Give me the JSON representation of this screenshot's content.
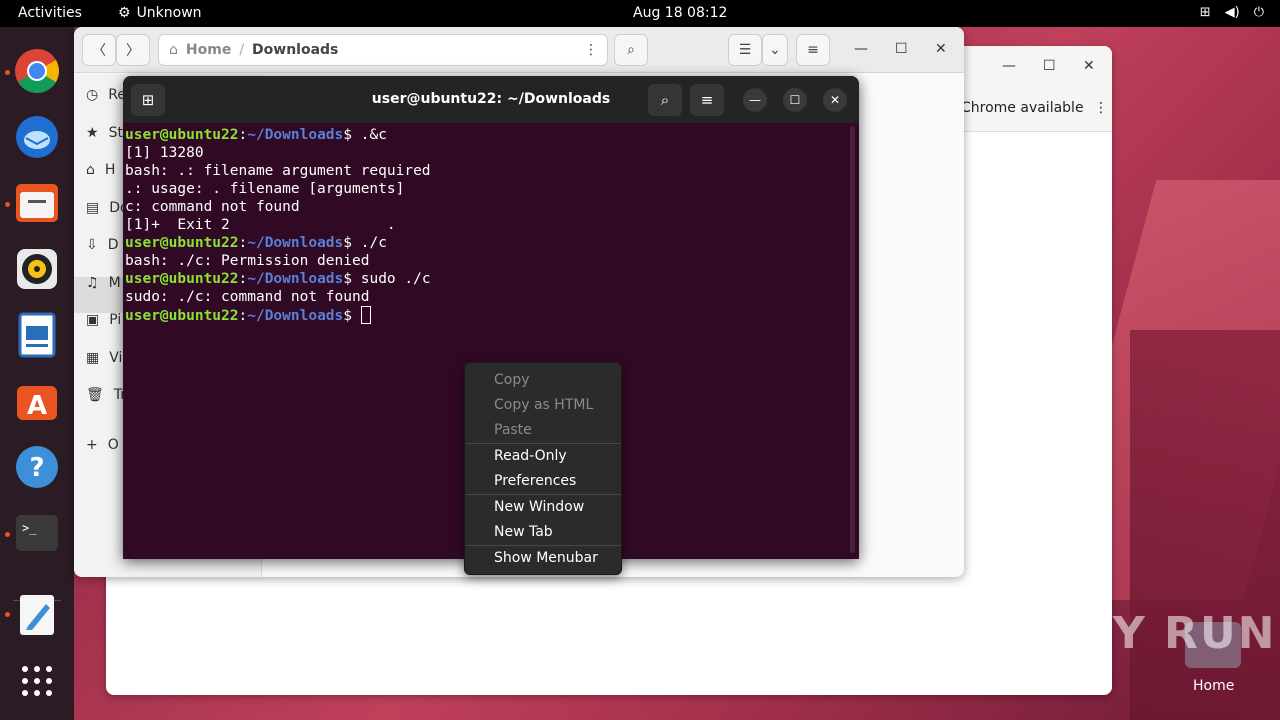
{
  "topbar": {
    "activities": "Activities",
    "app_name": "Unknown",
    "clock": "Aug 18  08:12",
    "tray_icons": [
      "network-icon",
      "volume-icon",
      "power-icon"
    ]
  },
  "dock": {
    "items": [
      "chrome",
      "thunderbird",
      "files",
      "rhythmbox",
      "writer",
      "app-center",
      "help",
      "terminal",
      "text-editor",
      "show-apps"
    ]
  },
  "bgwin": {
    "notice": "Chrome available"
  },
  "files": {
    "path_home": "Home",
    "path_sep": "/",
    "path_current": "Downloads",
    "sidebar": [
      "Re",
      "St",
      "H",
      "Do",
      "D",
      "M",
      "Pi",
      "Vi",
      "Tr",
      "O"
    ]
  },
  "terminal": {
    "title": "user@ubuntu22: ~/Downloads",
    "prompt_user": "user@ubuntu22",
    "prompt_sep": ":",
    "prompt_path": "~/Downloads",
    "prompt_end": "$ ",
    "lines": [
      {
        "type": "cmd",
        "text": ".&c"
      },
      {
        "type": "out",
        "text": "[1] 13280"
      },
      {
        "type": "out",
        "text": "bash: .: filename argument required"
      },
      {
        "type": "out",
        "text": ".: usage: . filename [arguments]"
      },
      {
        "type": "out",
        "text": "c: command not found"
      },
      {
        "type": "out",
        "text": "[1]+  Exit 2                  ."
      },
      {
        "type": "cmd",
        "text": "./c"
      },
      {
        "type": "out",
        "text": "bash: ./c: Permission denied"
      },
      {
        "type": "cmd",
        "text": "sudo ./c"
      },
      {
        "type": "out",
        "text": "sudo: ./c: command not found"
      },
      {
        "type": "cmd",
        "text": ""
      }
    ]
  },
  "context_menu": {
    "copy": "Copy",
    "copy_html": "Copy as HTML",
    "paste": "Paste",
    "read_only": "Read-Only",
    "preferences": "Preferences",
    "new_window": "New Window",
    "new_tab": "New Tab",
    "show_menubar": "Show Menubar"
  },
  "watermark": "ANY RUN",
  "desktop_home_label": "Home"
}
